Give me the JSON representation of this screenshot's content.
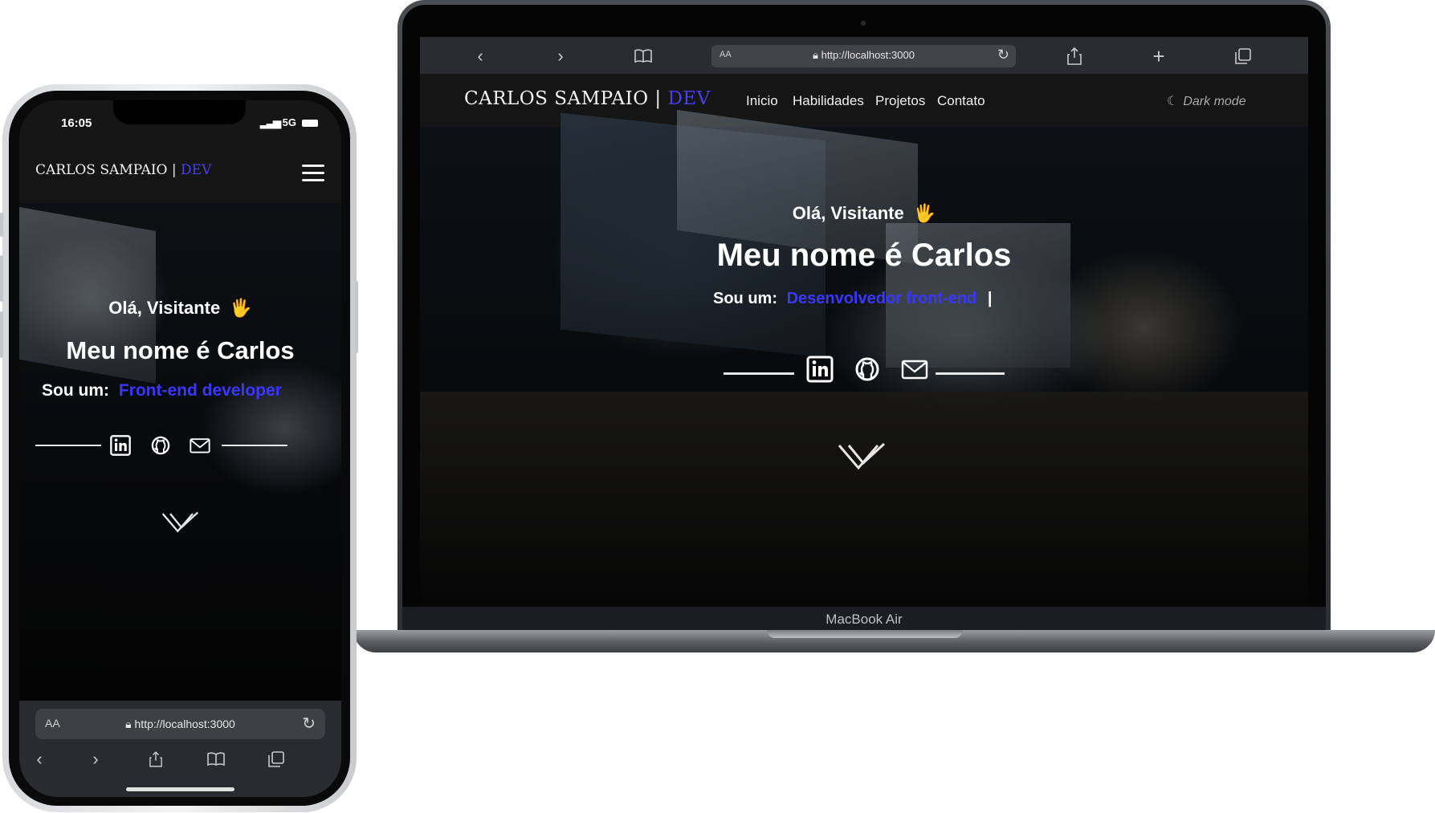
{
  "laptop": {
    "device_label": "MacBook Air",
    "browser": {
      "url_aa": "AA",
      "url": "http://localhost:3000",
      "icons": [
        "back-icon",
        "forward-icon",
        "bookmarks-icon",
        "reload-icon",
        "share-icon",
        "new-tab-icon",
        "tabs-icon"
      ]
    },
    "site": {
      "brand_name": "CARLOS SAMPAIO |",
      "brand_accent": "DEV",
      "nav": [
        "Inicio",
        "Habilidades",
        "Projetos",
        "Contato"
      ],
      "dark_mode": "Dark mode",
      "greeting": "Olá, Visitante",
      "greeting_emoji": "🖐",
      "title": "Meu nome é Carlos",
      "role_prefix": "Sou um:",
      "role_typed": "Desenvolvedor front-end",
      "caret": "|"
    }
  },
  "phone": {
    "status": {
      "time": "16:05",
      "signal": "5G"
    },
    "site": {
      "brand_name": "CARLOS SAMPAIO |",
      "brand_accent": "DEV",
      "greeting": "Olá, Visitante",
      "greeting_emoji": "🖐",
      "title": "Meu nome é Carlos",
      "role_prefix": "Sou um:",
      "role_typed": "Front-end developer"
    },
    "browser": {
      "url_aa": "AA",
      "url": "http://localhost:3000"
    }
  },
  "colors": {
    "accent": "#3a36ff",
    "navbar": "#151515",
    "toolbar": "#2b2c2f"
  }
}
